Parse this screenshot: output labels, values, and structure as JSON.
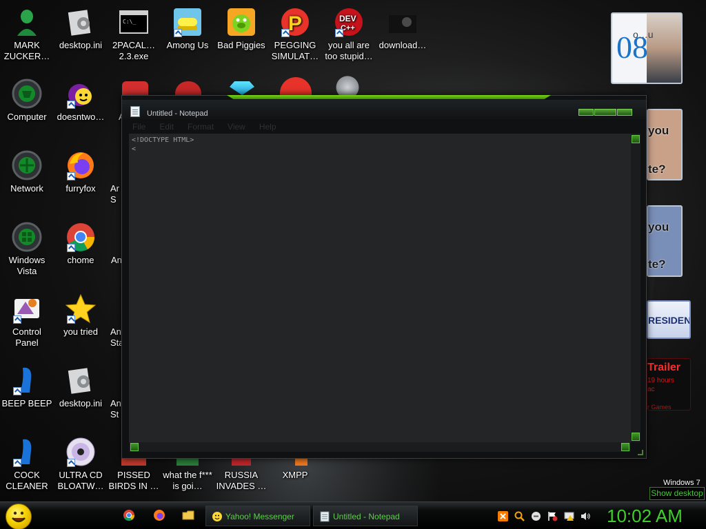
{
  "desktop": {
    "icons": [
      {
        "label": "MARK ZUCKER…",
        "icon": "green-alien-icon"
      },
      {
        "label": "desktop.ini",
        "icon": "settings-file-icon"
      },
      {
        "label": "2PACAL… 2.3.exe",
        "icon": "console-icon"
      },
      {
        "label": "Among Us",
        "icon": "among-us-icon"
      },
      {
        "label": "Bad Piggies",
        "icon": "bad-piggies-icon"
      },
      {
        "label": "PEGGING SIMULAT…",
        "icon": "p-logo-icon"
      },
      {
        "label": "you all are too stupid…",
        "icon": "dev-cpp-icon"
      },
      {
        "label": "download…",
        "icon": "image-thumb-icon"
      },
      {
        "label": "Computer",
        "icon": "computer-icon"
      },
      {
        "label": "doesntwo…",
        "icon": "yahoo-icon"
      },
      {
        "label": "Network",
        "icon": "network-icon"
      },
      {
        "label": "furryfox",
        "icon": "firefox-icon"
      },
      {
        "label": "Windows Vista",
        "icon": "vista-icon"
      },
      {
        "label": "chome",
        "icon": "chrome-icon"
      },
      {
        "label": "Control Panel",
        "icon": "control-panel-icon"
      },
      {
        "label": "you tried",
        "icon": "star-icon"
      },
      {
        "label": "BEEP BEEP",
        "icon": "blue-tube-icon"
      },
      {
        "label": "desktop.ini",
        "icon": "settings-file-icon"
      },
      {
        "label": "COCK CLEANER",
        "icon": "blue-tube-icon"
      },
      {
        "label": "ULTRA CD BLOATW…",
        "icon": "cd-icon"
      },
      {
        "label": "PISSED BIRDS IN …",
        "icon": "angry-bird-icon"
      },
      {
        "label": "what the f*** is goi…",
        "icon": "game-icon"
      },
      {
        "label": "RUSSIA INVADES …",
        "icon": "game-icon"
      },
      {
        "label": "XMPP",
        "icon": "xmpp-icon"
      }
    ],
    "partial_labels": [
      "Ar",
      "Ar S",
      "An",
      "An Sta",
      "An St"
    ],
    "gadgets": {
      "clock_number": "08",
      "clock_overlay": "o…u",
      "photo1_lines": [
        "you",
        "te?"
      ],
      "photo2_lines": [
        "you",
        "te?"
      ],
      "president": "RESIDENT",
      "trailer_title": "Trailer",
      "trailer_line1": "19 hours",
      "trailer_line2": "ac",
      "trailer_line3": "r Games"
    },
    "windows_brand": "Windows 7",
    "show_desktop": "Show desktop"
  },
  "notepad": {
    "title": "Untitled - Notepad",
    "menu": [
      "File",
      "Edit",
      "Format",
      "View",
      "Help"
    ],
    "content": [
      "<!DOCTYPE HTML>",
      "<"
    ]
  },
  "taskbar": {
    "tasks": [
      "Yahoo! Messenger",
      "Untitled - Notepad"
    ],
    "clock": "10:02 AM"
  },
  "colors": {
    "accent_green": "#5dd14a",
    "clock_green": "#3fce2c"
  }
}
